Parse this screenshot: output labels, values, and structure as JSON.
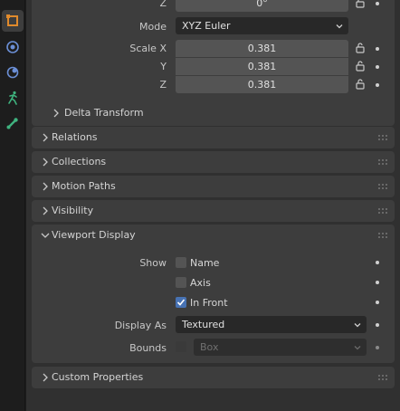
{
  "tabs": [
    {
      "icon": "object-icon",
      "active": true
    },
    {
      "icon": "physics-icon",
      "active": false
    },
    {
      "icon": "constraints-icon",
      "active": false
    },
    {
      "icon": "object-data-icon",
      "active": false
    },
    {
      "icon": "bone-icon",
      "active": false
    }
  ],
  "transform": {
    "z_label": "Z",
    "z_value": "0°",
    "mode_label": "Mode",
    "mode_value": "XYZ Euler",
    "scale_x_label": "Scale X",
    "scale_x_value": "0.381",
    "scale_y_label": "Y",
    "scale_y_value": "0.381",
    "scale_z_label": "Z",
    "scale_z_value": "0.381",
    "delta_label": "Delta Transform"
  },
  "panels": {
    "relations": "Relations",
    "collections": "Collections",
    "motion_paths": "Motion Paths",
    "visibility": "Visibility",
    "viewport_display": "Viewport Display",
    "custom_properties": "Custom Properties"
  },
  "viewport": {
    "show_label": "Show",
    "name_label": "Name",
    "name_checked": false,
    "axis_label": "Axis",
    "axis_checked": false,
    "in_front_label": "In Front",
    "in_front_checked": true,
    "display_as_label": "Display As",
    "display_as_value": "Textured",
    "bounds_label": "Bounds",
    "bounds_checked": false,
    "bounds_value": "Box"
  },
  "colors": {
    "accent": "#4772b3",
    "active_tab_icon": "#e08a2c",
    "physics_icon": "#6b8fd6",
    "green_icon": "#3fb37f"
  }
}
